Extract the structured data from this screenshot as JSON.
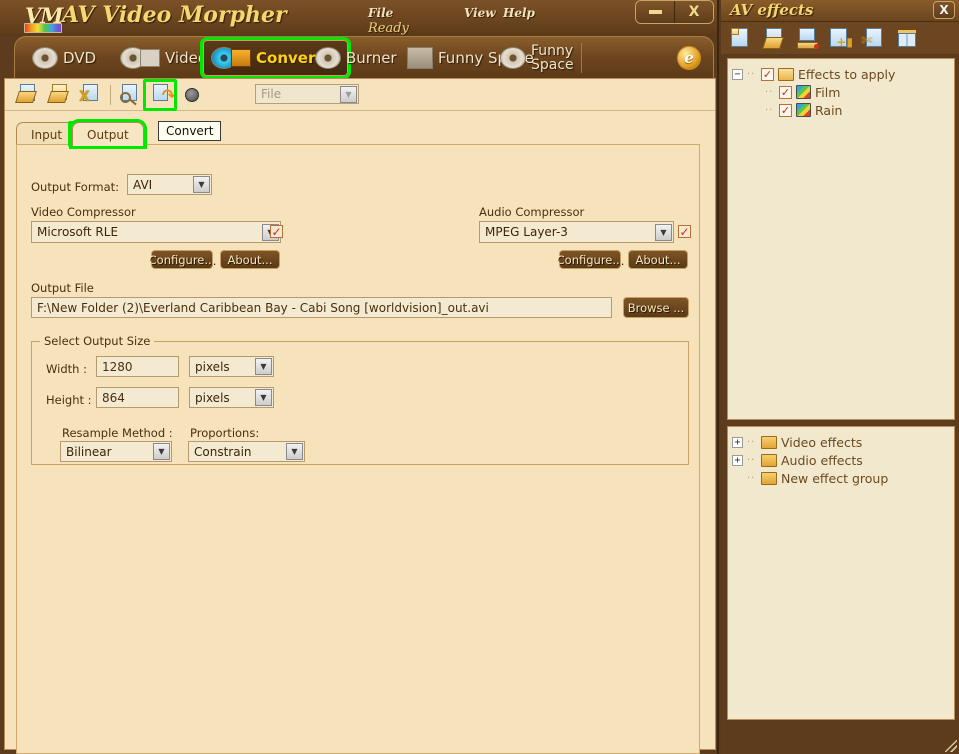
{
  "app": {
    "title": "AV Video Morpher",
    "logo_text": "VM",
    "status": "Ready",
    "menu": [
      {
        "label": "File",
        "name": "menu-file"
      },
      {
        "label": "View",
        "name": "menu-view"
      },
      {
        "label": "Help",
        "name": "menu-help"
      }
    ],
    "window_buttons": {
      "minimize": "minimize",
      "close": "X"
    }
  },
  "product_tabs": [
    {
      "label": "DVD",
      "icon": "dvd-disc-icon",
      "active": false
    },
    {
      "label": "Video",
      "icon": "video-disc-icon",
      "active": false
    },
    {
      "label": "Converter",
      "icon": "converter-icon",
      "active": true
    },
    {
      "label": "Burner",
      "icon": "burner-disc-icon",
      "active": false
    },
    {
      "label": "Funny Space",
      "icon": "funny-space-icon",
      "active": false
    }
  ],
  "toolbar": {
    "icons": [
      {
        "name": "open-video-icon",
        "title": "Open video"
      },
      {
        "name": "open-file-list-icon",
        "title": "Open file list"
      },
      {
        "name": "remove-file-icon",
        "title": "Remove file"
      },
      {
        "name": "preview-icon",
        "title": "Preview"
      },
      {
        "name": "convert-icon",
        "title": "Convert",
        "highlighted": true
      },
      {
        "name": "stop-icon",
        "title": "Stop"
      }
    ],
    "file_combo": {
      "value": "File",
      "disabled": true
    },
    "tooltip": "Convert"
  },
  "io_tabs": [
    {
      "label": "Input",
      "active": false
    },
    {
      "label": "Output",
      "active": true,
      "highlighted": true
    }
  ],
  "output_panel": {
    "output_format": {
      "label": "Output Format:",
      "value": "AVI"
    },
    "video_compressor": {
      "label": "Video Compressor",
      "value": "Microsoft RLE",
      "checked": true,
      "configure_label": "Configure...",
      "about_label": "About..."
    },
    "audio_compressor": {
      "label": "Audio Compressor",
      "value": "MPEG Layer-3",
      "checked": true,
      "configure_label": "Configure...",
      "about_label": "About..."
    },
    "output_file": {
      "label": "Output File",
      "value": "F:\\New Folder (2)\\Everland Caribbean Bay - Cabi Song [worldvision]_out.avi",
      "browse_label": "Browse ..."
    },
    "output_size": {
      "group_title": "Select Output Size",
      "width": {
        "label": "Width :",
        "value": "1280",
        "unit": "pixels"
      },
      "height": {
        "label": "Height :",
        "value": "864",
        "unit": "pixels"
      },
      "resample": {
        "label": "Resample Method :",
        "value": "Bilinear"
      },
      "proportions": {
        "label": "Proportions:",
        "value": "Constrain"
      }
    }
  },
  "fx_panel": {
    "title": "AV effects",
    "close_label": "X",
    "toolbar_icons": [
      {
        "name": "new-effect-icon"
      },
      {
        "name": "open-effect-icon"
      },
      {
        "name": "save-effect-icon"
      },
      {
        "name": "add-effect-group-icon"
      },
      {
        "name": "delete-effect-icon"
      },
      {
        "name": "split-view-icon"
      }
    ],
    "tree_applied": [
      {
        "label": "Effects to apply",
        "level": 0,
        "expander": "-",
        "checked": true,
        "icon": "open-folder-icon"
      },
      {
        "label": "Film",
        "level": 1,
        "expander": "",
        "checked": true,
        "icon": "effect-icon"
      },
      {
        "label": "Rain",
        "level": 1,
        "expander": "",
        "checked": true,
        "icon": "effect-icon"
      }
    ],
    "tree_library": [
      {
        "label": "Video effects",
        "expander": "+",
        "icon": "folder-icon"
      },
      {
        "label": "Audio effects",
        "expander": "+",
        "icon": "folder-icon"
      },
      {
        "label": "New effect group",
        "expander": "",
        "icon": "folder-icon"
      }
    ]
  },
  "colors": {
    "accent_green": "#00e800",
    "title_gold": "#f6d76f",
    "panel_bg": "#f7e3bb",
    "chrome_brown": "#5d3c1d",
    "field_bg": "#f4ead2",
    "check_red": "#cc2b12"
  }
}
